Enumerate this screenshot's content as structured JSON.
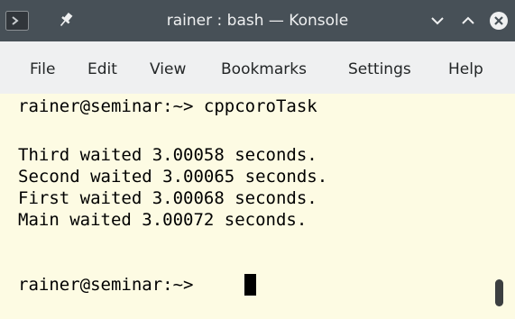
{
  "window": {
    "title": "rainer : bash — Konsole"
  },
  "titlebar_icons": {
    "app": "konsole-app-icon",
    "pin": "pin-icon",
    "minimize": "chevron-down-icon",
    "maximize": "chevron-up-icon",
    "close": "close-icon"
  },
  "menu": {
    "items": [
      "File",
      "Edit",
      "View",
      "Bookmarks",
      "Settings",
      "Help"
    ]
  },
  "terminal": {
    "lines": [
      "rainer@seminar:~> cppcoroTask",
      "",
      "Third waited 3.00058 seconds.",
      "Second waited 3.00065 seconds.",
      "First waited 3.00068 seconds.",
      "Main waited 3.00072 seconds.",
      "",
      "rainer@seminar:~> "
    ]
  },
  "colors": {
    "titlebar": "#475057",
    "menubar": "#eff0f1",
    "terminal_bg": "#fdfbe3",
    "terminal_fg": "#000000"
  }
}
